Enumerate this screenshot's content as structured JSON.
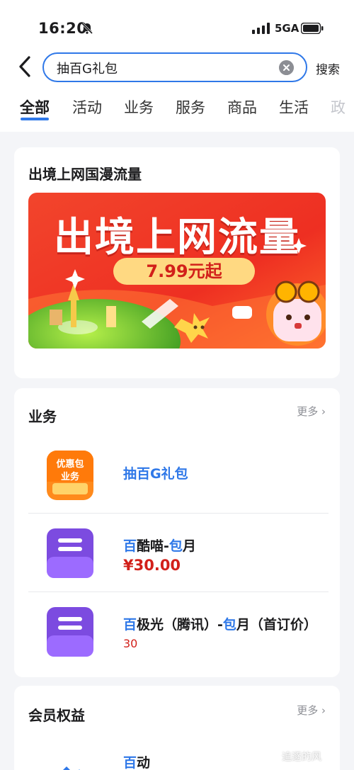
{
  "status_bar": {
    "time": "16:20",
    "network": "5GA"
  },
  "search": {
    "query": "抽百G礼包",
    "button_label": "搜索"
  },
  "tabs": [
    "全部",
    "活动",
    "业务",
    "服务",
    "商品",
    "生活",
    "政"
  ],
  "roaming_card": {
    "title": "出境上网国漫流量",
    "banner_title": "出境上网流量",
    "banner_price": "7.99元起"
  },
  "business": {
    "title": "业务",
    "more": "更多",
    "icon_text_line1": "优惠包",
    "icon_text_line2": "业务",
    "items": [
      {
        "name": "抽百G礼包"
      },
      {
        "name_hl1": "百",
        "name_mid": "酷喵-",
        "name_hl2": "包",
        "name_end": "月",
        "price": "¥30.00"
      },
      {
        "name_hl1": "百",
        "name_mid": "极光（腾讯）-",
        "name_hl2": "包",
        "name_end": "月（首订价）",
        "price": "30"
      }
    ]
  },
  "membership": {
    "title": "会员权益",
    "more": "更多",
    "first_item_hl": "百",
    "first_item_rest": "动"
  },
  "watermark": "追逐的风",
  "colors": {
    "accent": "#2f78e8",
    "price": "#d2201a",
    "banner_red": "#f03a24",
    "icon_purple": "#7c4be0",
    "icon_orange": "#ff8a1c"
  }
}
